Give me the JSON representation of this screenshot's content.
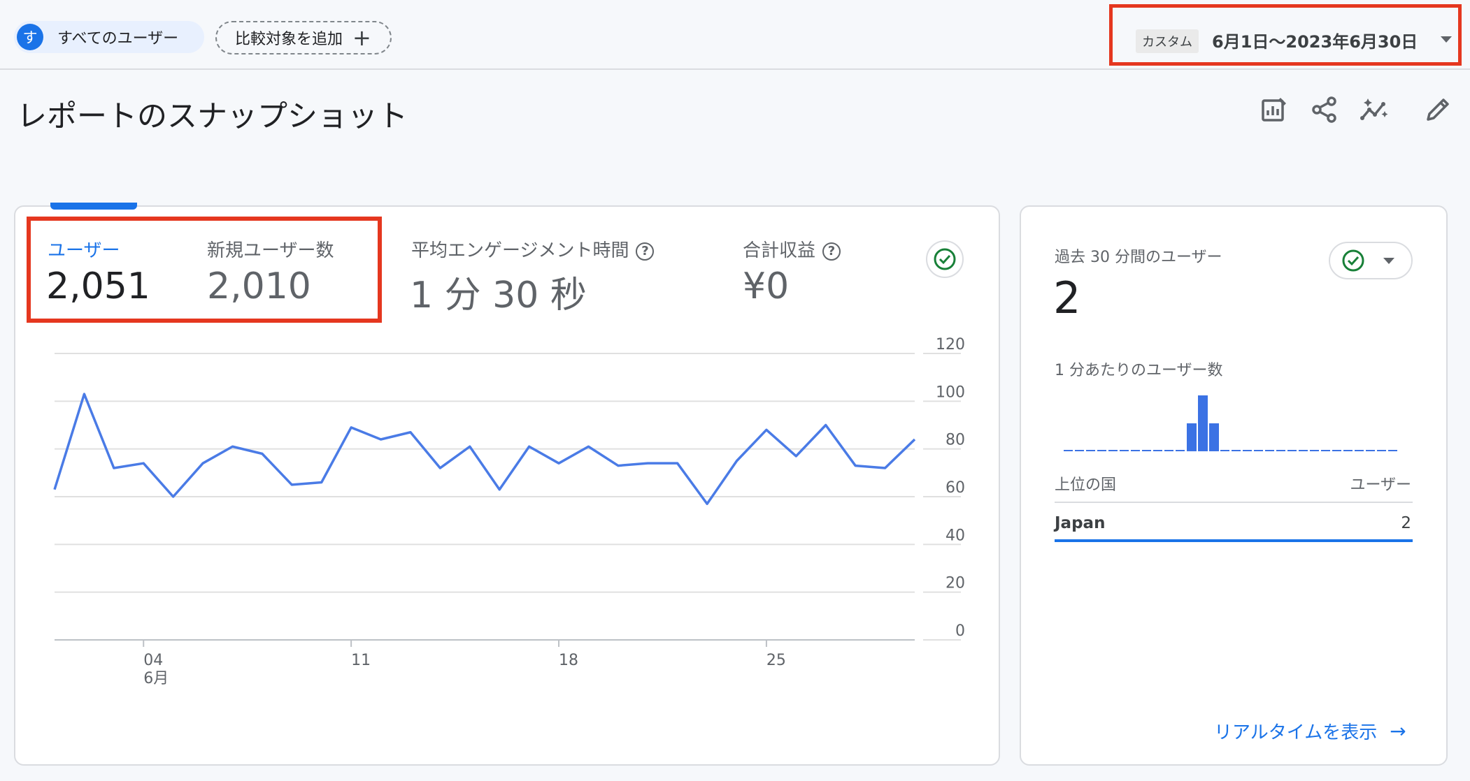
{
  "segment": {
    "avatar_letter": "す",
    "label": "すべてのユーザー"
  },
  "compare": {
    "label": "比較対象を追加",
    "icon": "plus-icon"
  },
  "date": {
    "tag": "カスタム",
    "range": "6月1日〜2023年6月30日"
  },
  "page": {
    "title": "レポートのスナップショット"
  },
  "toolbar": {
    "icons": [
      "customize-report-icon",
      "share-icon",
      "insights-icon",
      "edit-icon"
    ]
  },
  "metrics": [
    {
      "label": "ユーザー",
      "value": "2,051",
      "active": true
    },
    {
      "label": "新規ユーザー数",
      "value": "2,010",
      "active": false
    },
    {
      "label": "平均エンゲージメント時間",
      "value": "1 分 30 秒",
      "active": false
    },
    {
      "label": "合計収益",
      "value": "¥0",
      "active": false
    }
  ],
  "chart_data": {
    "type": "line",
    "x": [
      "6/1",
      "6/2",
      "6/3",
      "6/4",
      "6/5",
      "6/6",
      "6/7",
      "6/8",
      "6/9",
      "6/10",
      "6/11",
      "6/12",
      "6/13",
      "6/14",
      "6/15",
      "6/16",
      "6/17",
      "6/18",
      "6/19",
      "6/20",
      "6/21",
      "6/22",
      "6/23",
      "6/24",
      "6/25",
      "6/26",
      "6/27",
      "6/28",
      "6/29",
      "6/30"
    ],
    "series": [
      {
        "values": [
          63,
          103,
          72,
          74,
          60,
          74,
          81,
          78,
          65,
          66,
          89,
          84,
          87,
          72,
          81,
          63,
          81,
          74,
          81,
          73,
          74,
          74,
          57,
          75,
          88,
          77,
          90,
          73,
          72,
          84
        ]
      }
    ],
    "xticks": [
      {
        "index": 3,
        "label": "04",
        "sub": "6月"
      },
      {
        "index": 10,
        "label": "11",
        "sub": ""
      },
      {
        "index": 17,
        "label": "18",
        "sub": ""
      },
      {
        "index": 24,
        "label": "25",
        "sub": ""
      }
    ],
    "yticks": [
      0,
      20,
      40,
      60,
      80,
      100,
      120
    ],
    "ylim": [
      0,
      120
    ],
    "grid": true,
    "color": "#4a7be6"
  },
  "realtime": {
    "title": "過去 30 分間のユーザー",
    "value": "2",
    "per_minute_label": "1 分あたりのユーザー数",
    "per_minute": [
      0,
      0,
      0,
      0,
      0,
      0,
      0,
      0,
      0,
      0,
      0,
      1,
      2,
      1,
      0,
      0,
      0,
      0,
      0,
      0,
      0,
      0,
      0,
      0,
      0,
      0,
      0,
      0,
      0,
      0
    ],
    "table_head_left": "上位の国",
    "table_head_right": "ユーザー",
    "rows": [
      {
        "country": "Japan",
        "users": "2"
      }
    ],
    "link": "リアルタイムを表示"
  },
  "colors": {
    "accent": "#1a73e8",
    "highlight": "#e5371f",
    "success": "#188038"
  }
}
